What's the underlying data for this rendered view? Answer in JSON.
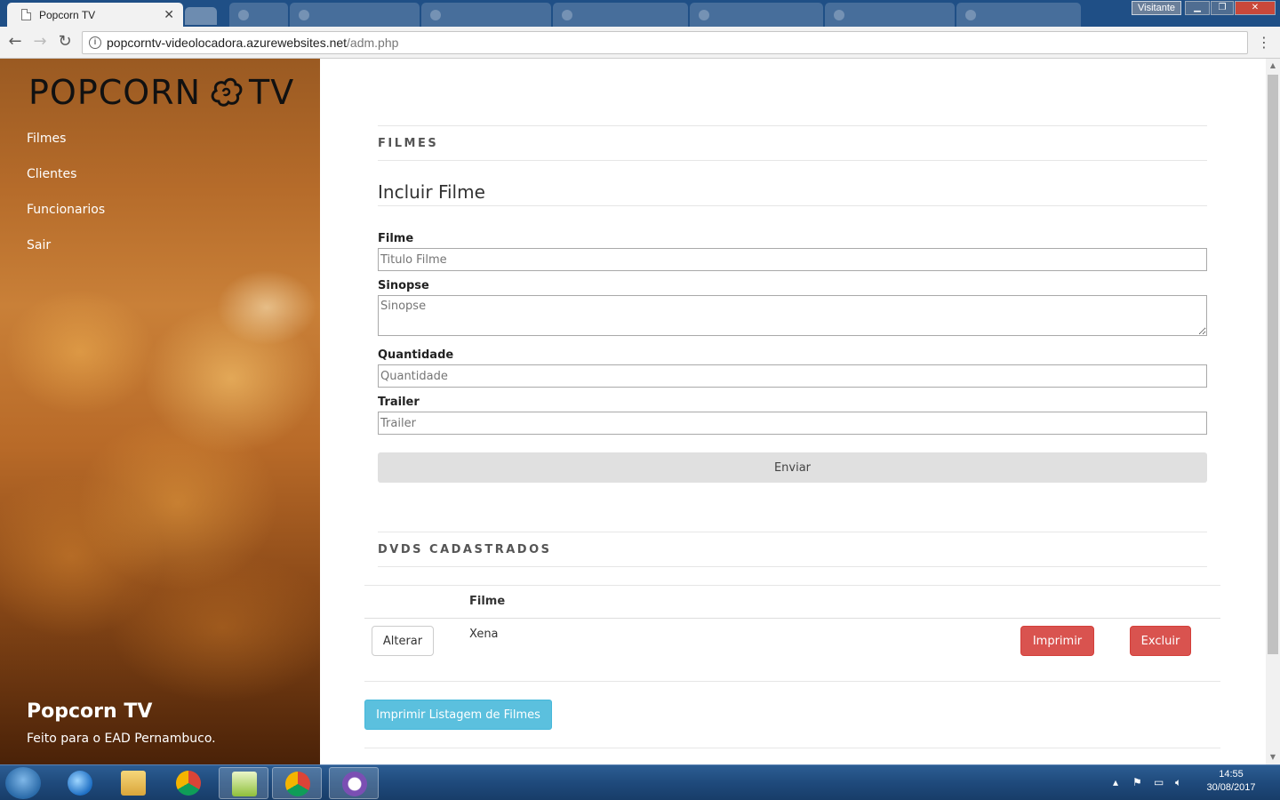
{
  "browser": {
    "active_tab_title": "Popcorn TV",
    "background_tabs": [
      "",
      "",
      "",
      "",
      "",
      "",
      ""
    ],
    "user_badge": "Visitante",
    "url_host": "popcorntv-videolocadora.azurewebsites.net",
    "url_path": "/adm.php"
  },
  "sidebar": {
    "logo_left": "POPCORN",
    "logo_right": "TV",
    "nav": [
      "Filmes",
      "Clientes",
      "Funcionarios",
      "Sair"
    ],
    "brand_title": "Popcorn TV",
    "brand_subtitle": "Feito para o EAD Pernambuco."
  },
  "main": {
    "section_filmes": "FILMES",
    "form_title": "Incluir Filme",
    "fields": {
      "filme": {
        "label": "Filme",
        "placeholder": "Titulo Filme",
        "value": ""
      },
      "sinopse": {
        "label": "Sinopse",
        "placeholder": "Sinopse",
        "value": ""
      },
      "quantidade": {
        "label": "Quantidade",
        "placeholder": "Quantidade",
        "value": ""
      },
      "trailer": {
        "label": "Trailer",
        "placeholder": "Trailer",
        "value": ""
      }
    },
    "submit_label": "Enviar",
    "section_dvds": "DVDS CADASTRADOS",
    "table": {
      "header_filme": "Filme",
      "rows": [
        {
          "alterar": "Alterar",
          "filme": "Xena",
          "imprimir": "Imprimir",
          "excluir": "Excluir"
        }
      ]
    },
    "print_list_label": "Imprimir Listagem de Filmes"
  },
  "taskbar": {
    "time": "14:55",
    "date": "30/08/2017"
  },
  "colors": {
    "danger": "#d9534f",
    "info": "#5bc0de",
    "taskbar": "#1f4a7c"
  }
}
